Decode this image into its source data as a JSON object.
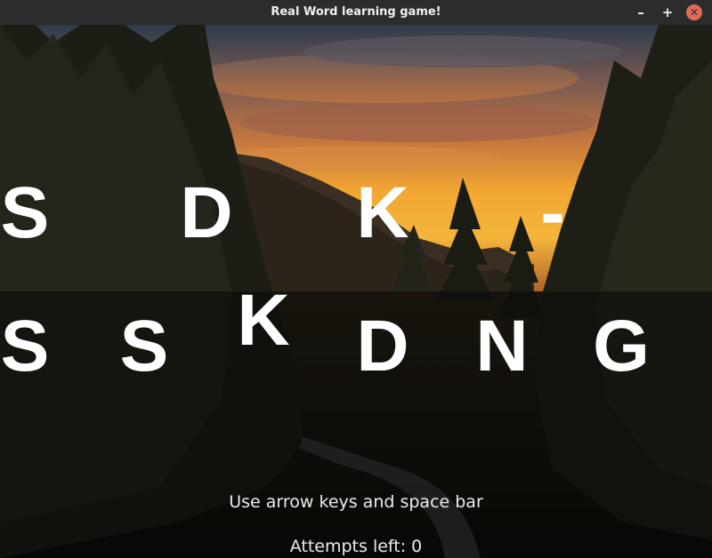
{
  "window": {
    "title": "Real Word learning game!",
    "minimize_label": "–",
    "maximize_label": "+",
    "close_label": "✕",
    "close_color": "#e06a5a"
  },
  "target_word": {
    "letters": [
      "S",
      "D",
      "K",
      "-"
    ]
  },
  "letter_choices": {
    "letters": [
      "S",
      "S",
      "K",
      "D",
      "N",
      "G"
    ]
  },
  "instructions": "Use arrow keys and space bar",
  "attempts_text": "Attempts left: 0",
  "background": {
    "subject": "sunset over forested mountain valley with winding road",
    "sky_colors": [
      "#2b3a4e",
      "#8a5a48",
      "#e59a3c",
      "#f6b83a"
    ]
  }
}
